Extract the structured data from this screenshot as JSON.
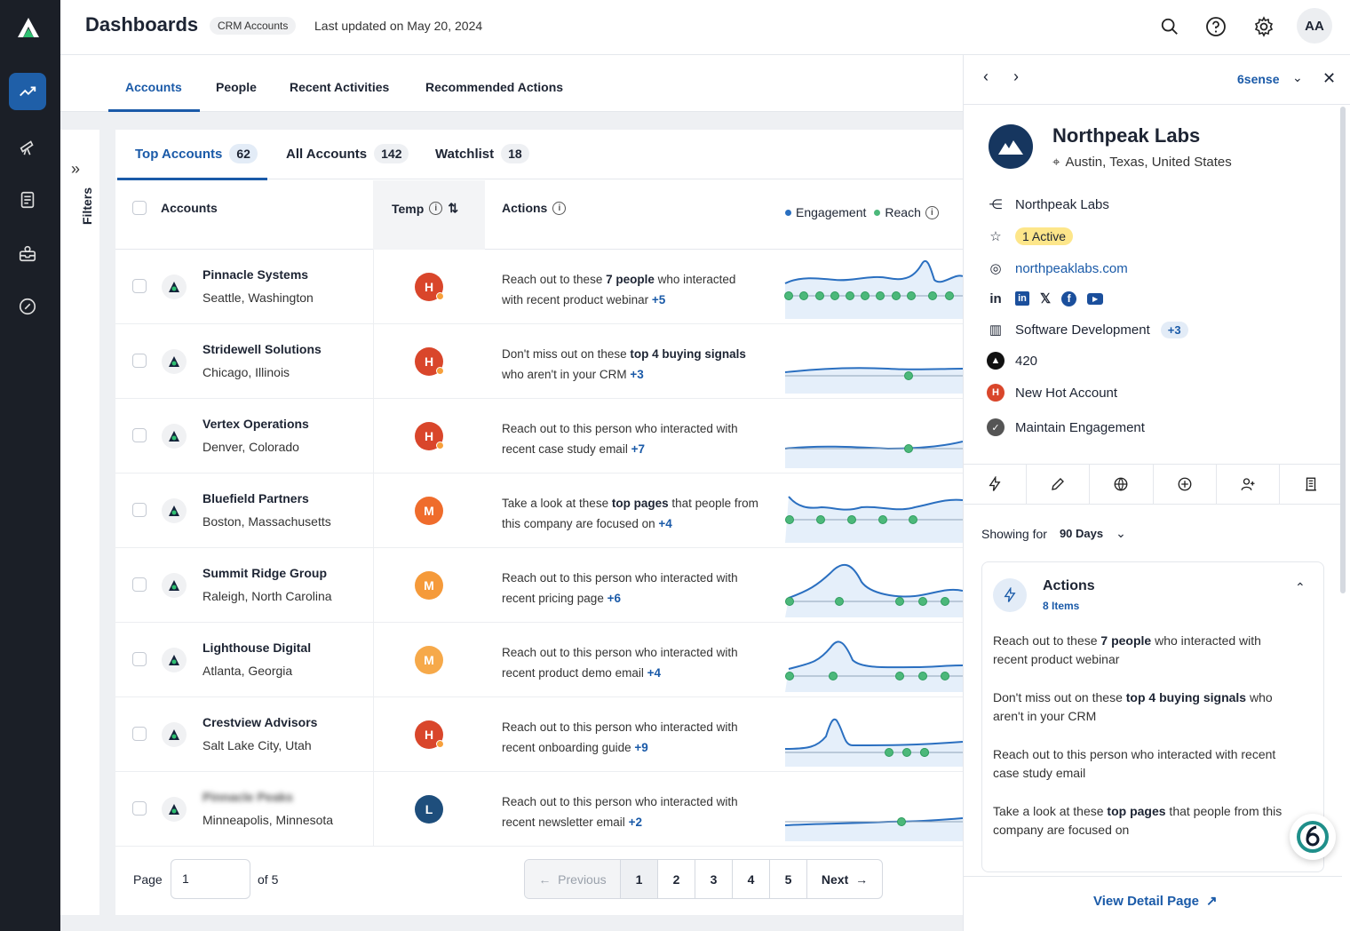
{
  "header": {
    "title": "Dashboards",
    "badge": "CRM Accounts",
    "updated": "Last updated on May 20, 2024",
    "avatar": "AA"
  },
  "tabs": [
    "Accounts",
    "People",
    "Recent Activities",
    "Recommended Actions"
  ],
  "filters_label": "Filters",
  "subtabs": [
    {
      "label": "Top Accounts",
      "count": "62"
    },
    {
      "label": "All Accounts",
      "count": "142"
    },
    {
      "label": "Watchlist",
      "count": "18"
    }
  ],
  "columns": {
    "accounts": "Accounts",
    "temp": "Temp",
    "actions": "Actions",
    "engagement": "Engagement",
    "reach": "Reach"
  },
  "rows": [
    {
      "name": "Pinnacle Systems",
      "loc": "Seattle, Washington",
      "temp": "H",
      "temp_color": "#d9462b",
      "pre": "Reach out to these ",
      "bold": "7 people",
      "post": " who interacted with recent product webinar",
      "bold2": "",
      "post2": "",
      "plus": "+5"
    },
    {
      "name": "Stridewell Solutions",
      "loc": "Chicago, Illinois",
      "temp": "H",
      "temp_color": "#d9462b",
      "pre": "Don't miss out on these ",
      "bold": "top 4 buying signals",
      "post": " who aren't in your CRM",
      "bold2": "",
      "post2": "",
      "plus": "+3"
    },
    {
      "name": "Vertex Operations",
      "loc": "Denver, Colorado",
      "temp": "H",
      "temp_color": "#d9462b",
      "pre": "Reach out to this person who interacted with recent case study email",
      "bold": "",
      "post": "",
      "bold2": "",
      "post2": "",
      "plus": "+7"
    },
    {
      "name": "Bluefield Partners",
      "loc": "Boston, Massachusetts",
      "temp": "M",
      "temp_color": "#ef6c2c",
      "pre": "Take a look at these ",
      "bold": "top pages",
      "post": " that people from this company are focused on",
      "bold2": "",
      "post2": "",
      "plus": "+4"
    },
    {
      "name": "Summit Ridge Group",
      "loc": "Raleigh, North Carolina",
      "temp": "M",
      "temp_color": "#f59a3a",
      "pre": "Reach out to this person who interacted with recent pricing page",
      "bold": "",
      "post": "",
      "bold2": "",
      "post2": "",
      "plus": "+6"
    },
    {
      "name": "Lighthouse Digital",
      "loc": "Atlanta, Georgia",
      "temp": "M",
      "temp_color": "#f6a94a",
      "pre": "Reach out to this person who interacted with recent product demo email",
      "bold": "",
      "post": "",
      "bold2": "",
      "post2": "",
      "plus": "+4"
    },
    {
      "name": "Crestview Advisors",
      "loc": "Salt Lake City, Utah",
      "temp": "H",
      "temp_color": "#d9462b",
      "pre": "Reach out to this person who interacted with recent onboarding guide",
      "bold": "",
      "post": "",
      "bold2": "",
      "post2": "",
      "plus": "+9"
    },
    {
      "name": "Pinnacle Peaks",
      "loc": "Minneapolis, Minnesota",
      "temp": "L",
      "temp_color": "#1e4e7c",
      "pre": "Reach out to this person who interacted with recent newsletter email",
      "bold": "",
      "post": "",
      "bold2": "",
      "post2": "",
      "plus": "+2"
    }
  ],
  "pager": {
    "page_label": "Page",
    "page_value": "1",
    "of": "of 5",
    "prev": "Previous",
    "pages": [
      "1",
      "2",
      "3",
      "4",
      "5"
    ],
    "next": "Next"
  },
  "panel": {
    "source": "6sense",
    "company": "Northpeak Labs",
    "location": "Austin, Texas, United States",
    "org": "Northpeak Labs",
    "active": "1 Active",
    "website": "northpeaklabs.com",
    "industry": "Software Development",
    "industry_more": "+3",
    "employees": "420",
    "status": "New Hot Account",
    "stage": "Maintain Engagement",
    "showing_for": "Showing for",
    "range": "90 Days",
    "actions_title": "Actions",
    "actions_count": "8 Items",
    "actions": [
      {
        "pre": "Reach out to these ",
        "bold": "7 people",
        "post": " who interacted with recent product webinar"
      },
      {
        "pre": "Don't miss out on these ",
        "bold": "top 4 buying signals",
        "post": " who aren't in your CRM"
      },
      {
        "pre": "Reach out to this person who interacted with recent case study email",
        "bold": "",
        "post": ""
      },
      {
        "pre": "Take a look at these ",
        "bold": "top pages",
        "post": " that people from this company are focused on"
      }
    ],
    "view_detail": "View Detail Page"
  },
  "colors": {
    "accent": "#1a5aa8",
    "rail": "#1b1f27",
    "reach": "#4cb87a",
    "engagement": "#2a6fc0"
  }
}
